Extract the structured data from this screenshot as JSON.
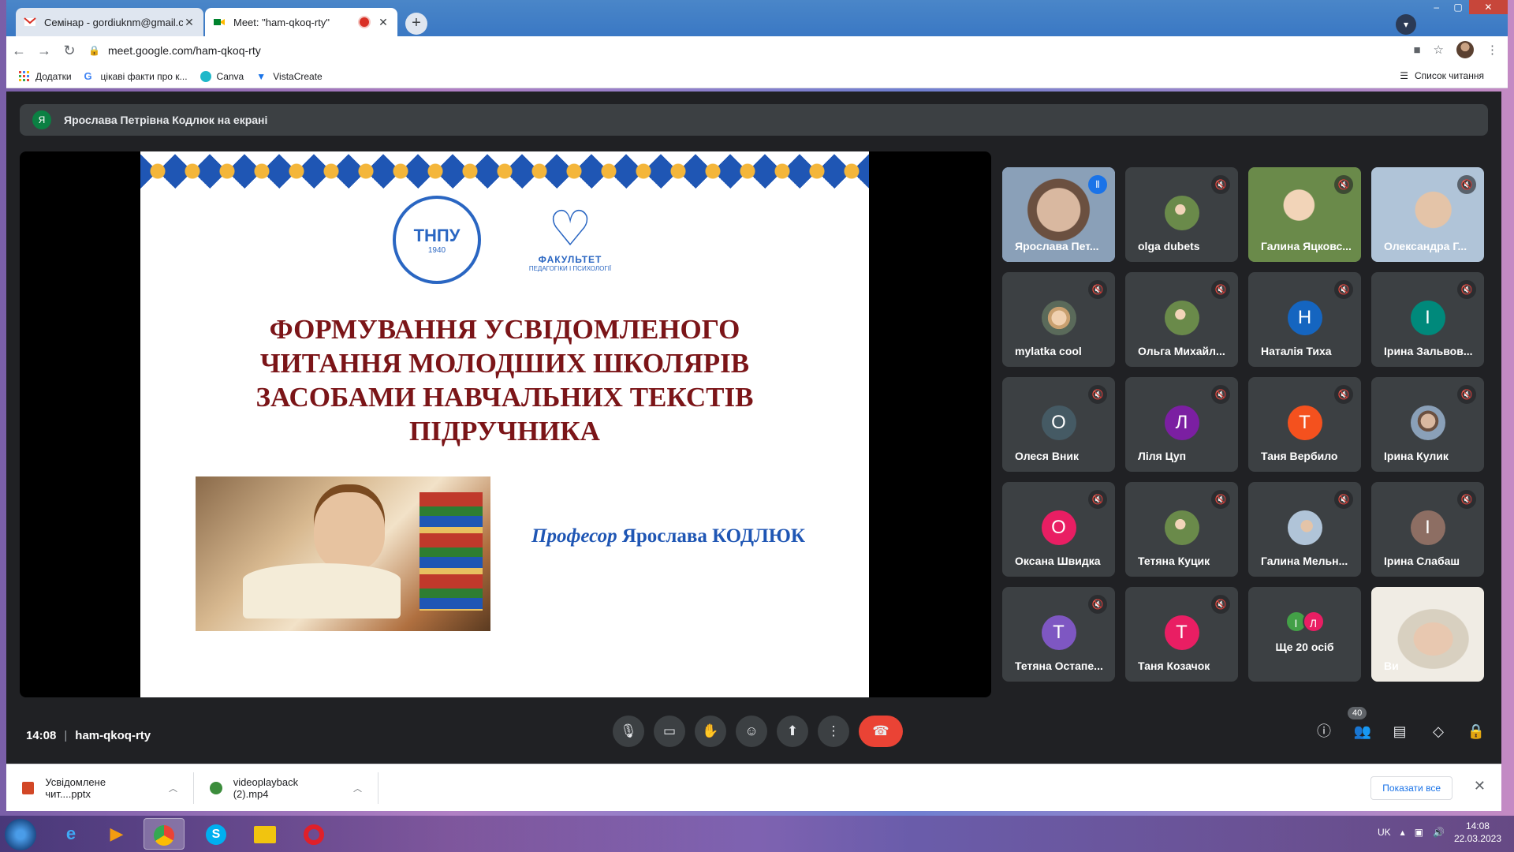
{
  "browser": {
    "tabs": [
      {
        "title": "Семінар - gordiuknm@gmail.com",
        "icon": "gmail-icon"
      },
      {
        "title": "Meet: \"ham-qkoq-rty\"",
        "icon": "meet-icon"
      }
    ],
    "url": "meet.google.com/ham-qkoq-rty",
    "bookmarks": [
      {
        "label": "Додатки",
        "icon": "apps-icon"
      },
      {
        "label": "цікаві факти про к...",
        "icon": "google-icon"
      },
      {
        "label": "Canva",
        "icon": "canva-icon"
      },
      {
        "label": "VistaCreate",
        "icon": "vistacreate-icon"
      }
    ],
    "reading_list": "Список читання"
  },
  "meet": {
    "presenter_initial": "Я",
    "presenting_text": "Ярослава Петрівна Кодлюк на екрані",
    "slide": {
      "logo_tnpu_text": "ТНПУ",
      "logo_tnpu_year": "1940",
      "logo_faculty_title": "ФАКУЛЬТЕТ",
      "logo_faculty_sub": "ПЕДАГОГІКИ І ПСИХОЛОГІЇ",
      "title_lines": [
        "ФОРМУВАННЯ УСВІДОМЛЕНОГО",
        "ЧИТАННЯ МОЛОДШИХ ШКОЛЯРІВ",
        "ЗАСОБАМИ НАВЧАЛЬНИХ ТЕКСТІВ",
        "ПІДРУЧНИКА"
      ],
      "author_prefix": "Професор",
      "author_name": "Ярослава КОДЛЮК"
    },
    "participants": [
      {
        "name": "Ярослава Пет...",
        "type": "video",
        "speaking": true
      },
      {
        "name": "olga dubets",
        "type": "photo",
        "muted": true
      },
      {
        "name": "Галина Яцковс...",
        "type": "video",
        "muted": true
      },
      {
        "name": "Олександра Г...",
        "type": "video",
        "muted": true
      },
      {
        "name": "mylatka cool",
        "type": "photo",
        "muted": true
      },
      {
        "name": "Ольга Михайл...",
        "type": "photo",
        "muted": true
      },
      {
        "name": "Наталія Тиха",
        "initial": "Н",
        "color": "#1565c0",
        "muted": true
      },
      {
        "name": "Ірина Зальвов...",
        "initial": "І",
        "color": "#00897b",
        "muted": true
      },
      {
        "name": "Олеся Вник",
        "initial": "О",
        "color": "#455a64",
        "muted": true
      },
      {
        "name": "Ліля Цуп",
        "initial": "Л",
        "color": "#7b1fa2",
        "muted": true
      },
      {
        "name": "Таня Вербило",
        "initial": "Т",
        "color": "#f4511e",
        "muted": true
      },
      {
        "name": "Ірина Кулик",
        "type": "photo",
        "muted": true
      },
      {
        "name": "Оксана Швидка",
        "initial": "О",
        "color": "#e91e63",
        "muted": true
      },
      {
        "name": "Тетяна Куцик",
        "type": "photo",
        "muted": true
      },
      {
        "name": "Галина Мельн...",
        "type": "photo",
        "muted": true
      },
      {
        "name": "Ірина Слабаш",
        "initial": "І",
        "color": "#8d6e63",
        "muted": true
      },
      {
        "name": "Тетяна Остапе...",
        "initial": "Т",
        "color": "#7e57c2",
        "muted": true
      },
      {
        "name": "Таня Козачок",
        "initial": "Т",
        "color": "#e91e63",
        "muted": true
      }
    ],
    "others": {
      "label": "Ще 20 осіб",
      "initials": [
        "І",
        "Л"
      ]
    },
    "self": {
      "name": "Ви"
    },
    "time": "14:08",
    "meeting_code": "ham-qkoq-rty",
    "people_count": "40",
    "controls": [
      "mic-icon",
      "camera-icon",
      "raise-hand-icon",
      "emoji-icon",
      "present-icon",
      "more-icon",
      "leave-call-icon"
    ],
    "right_controls": [
      "info-icon",
      "people-icon",
      "chat-icon",
      "activities-icon",
      "host-controls-icon"
    ]
  },
  "downloads": {
    "items": [
      {
        "name": "Усвідомлене чит....pptx",
        "icon": "pptx-file-icon"
      },
      {
        "name": "videoplayback (2).mp4",
        "icon": "video-file-icon"
      }
    ],
    "show_all": "Показати все"
  },
  "taskbar": {
    "apps": [
      "internet-explorer-icon",
      "media-player-icon",
      "chrome-icon",
      "skype-icon",
      "explorer-icon",
      "opera-icon"
    ],
    "language": "UK",
    "time": "14:08",
    "date": "22.03.2023"
  }
}
